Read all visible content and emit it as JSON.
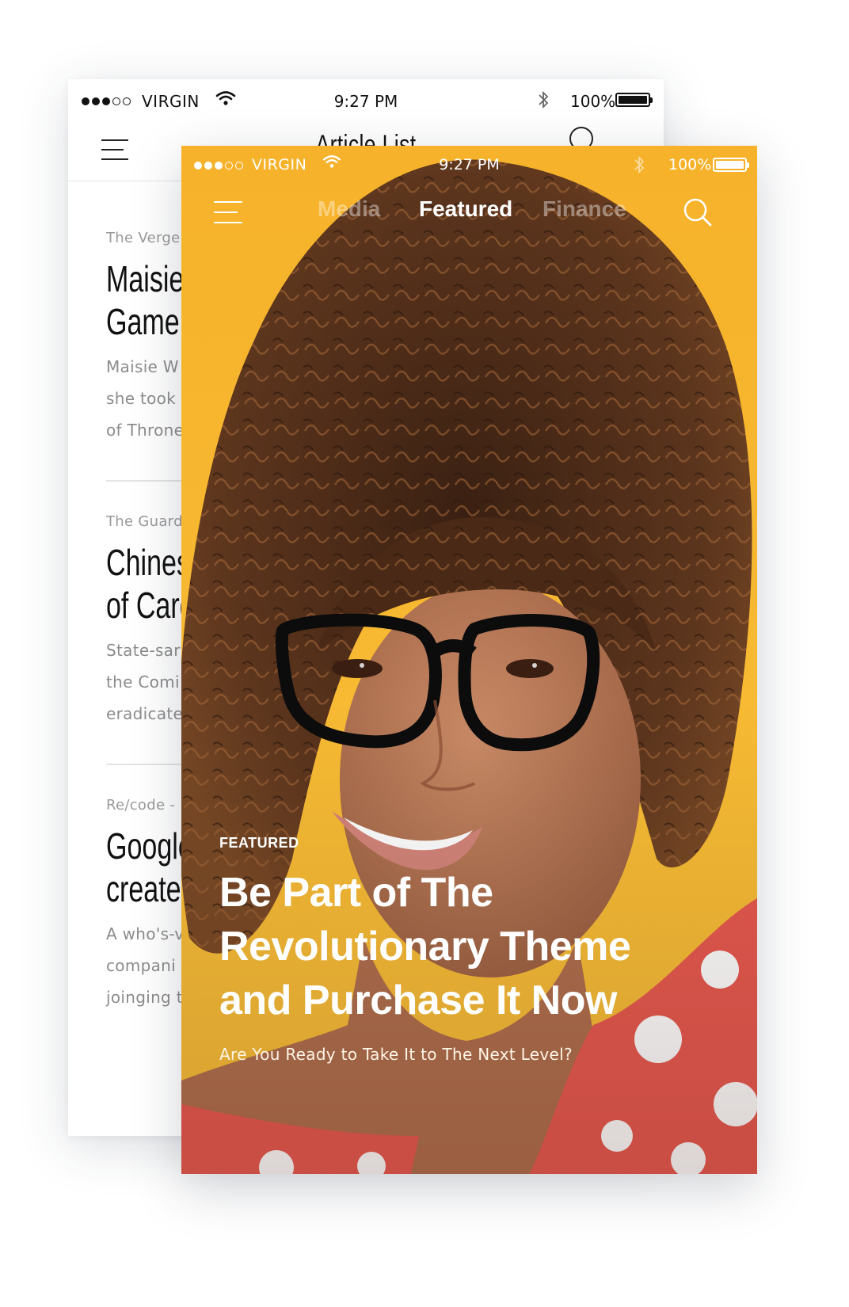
{
  "back_screen": {
    "status_bar": {
      "signal_dots_filled": 3,
      "signal_dots_total": 5,
      "carrier": "VIRGIN",
      "time": "9:27 PM",
      "battery": "100%"
    },
    "nav": {
      "title": "Article List"
    },
    "articles": [
      {
        "source": "The Verge",
        "headline_lines": [
          "Maisie",
          "Game o"
        ],
        "excerpt_lines": [
          "Maisie W",
          "she took",
          "of Throne"
        ]
      },
      {
        "source": "The Guard",
        "headline_lines": [
          "Chines",
          "of Card"
        ],
        "excerpt_lines": [
          "State-sar",
          "the Comi",
          "eradicate"
        ]
      },
      {
        "source": "Re/code -",
        "headline_lines": [
          "Google",
          "createc"
        ],
        "excerpt_lines": [
          "A who's-v",
          "compani",
          "joinging t"
        ]
      }
    ]
  },
  "front_screen": {
    "status_bar": {
      "signal_dots_filled": 3,
      "signal_dots_total": 5,
      "carrier": "VIRGIN",
      "time": "9:27 PM",
      "battery": "100%"
    },
    "tabs": [
      {
        "label": "Media",
        "active": false
      },
      {
        "label": "Featured",
        "active": true
      },
      {
        "label": "Finance",
        "active": false
      }
    ],
    "hero": {
      "kicker": "FEATURED",
      "headline_lines": [
        "Be Part of The",
        "Revolutionary Theme",
        "and Purchase It Now"
      ],
      "subtitle": "Are You Ready to Take It to The Next Level?"
    }
  },
  "colors": {
    "background_yellow": "#f7b52e",
    "hair_brown": "#5a3420",
    "skin": "#b87858",
    "dress_red": "#e85a50",
    "text_white": "#ffffff"
  }
}
